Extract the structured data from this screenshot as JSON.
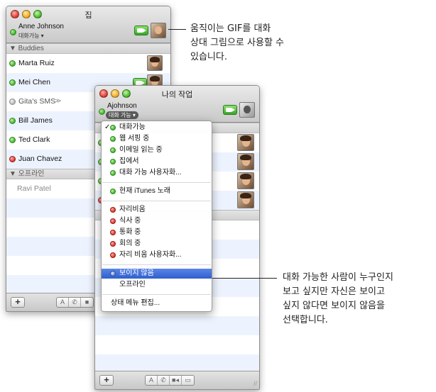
{
  "back_window": {
    "title": "집",
    "me": {
      "name": "Anne Johnson",
      "status": "대화가능 ▾"
    },
    "groups": {
      "buddies": "▼ Buddies",
      "offline": "▼ 오프라인"
    },
    "buddies": [
      {
        "name": "Marta Ruiz",
        "status": "green"
      },
      {
        "name": "Mei Chen",
        "status": "green"
      },
      {
        "name": "Gita's SMS",
        "status": "gray",
        "extra": "≫"
      },
      {
        "name": "Bill James",
        "status": "green"
      },
      {
        "name": "Ted Clark",
        "status": "green"
      },
      {
        "name": "Juan Chavez",
        "status": "red"
      }
    ],
    "offline": [
      {
        "name": "Ravi Patel"
      }
    ],
    "bottom": {
      "add": "+",
      "seg": [
        "A",
        "✆",
        "■"
      ]
    }
  },
  "front_window": {
    "title": "나의 작업",
    "me": {
      "name": "Ajohnson",
      "status": "대화 가능 ▾"
    },
    "bottom": {
      "add": "+",
      "seg": [
        "A",
        "✆",
        "■◂",
        "▭"
      ],
      "resize": "//"
    }
  },
  "status_menu": {
    "check_mark": "✓",
    "available": [
      {
        "label": "대화가능",
        "checked": true
      },
      {
        "label": "웹 서핑 중"
      },
      {
        "label": "이메일 읽는 중"
      },
      {
        "label": "집에서"
      },
      {
        "label": "대화 가능 사용자화..."
      }
    ],
    "itunes": {
      "label": "현재 iTunes 노래"
    },
    "away": [
      {
        "label": "자리비움"
      },
      {
        "label": "식사 중"
      },
      {
        "label": "통화 중"
      },
      {
        "label": "회의 중"
      },
      {
        "label": "자리 비움 사용자화..."
      }
    ],
    "invisible": "보이지 않음",
    "offline": "오프라인",
    "edit": "상태 메뉴 편집..."
  },
  "callouts": {
    "top": [
      "움직이는 GIF를 대화",
      "상대 그림으로 사용할 수",
      "있습니다."
    ],
    "bottom": [
      "대화 가능한 사람이 누구인지",
      "보고 싶지만 자신은 보이고",
      "싶지 않다면 보이지 않음을",
      "선택합니다."
    ]
  }
}
